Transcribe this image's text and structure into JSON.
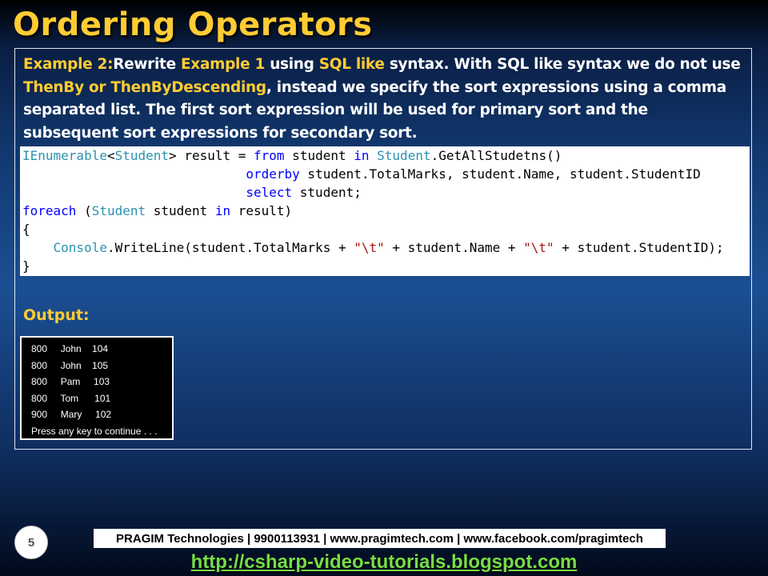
{
  "slide": {
    "title": "Ordering Operators",
    "page_number": "5"
  },
  "intro": {
    "example_label": "Example 2:",
    "t1": "Rewrite ",
    "example_ref": "Example 1",
    "t2": " using ",
    "sql_like": "SQL like",
    "t3": " syntax. With SQL like syntax we do not use ",
    "thenby": "ThenBy or ThenByDescending",
    "t4": ", instead we specify the sort expressions using a comma separated list. The first sort expression will be used for primary sort and the subsequent sort expressions for secondary sort."
  },
  "code": {
    "l1_type1": "IEnumerable",
    "l1_lt": "<",
    "l1_type2": "Student",
    "l1_mid": "> result = ",
    "l1_from": "from",
    "l1_student": " student ",
    "l1_in": "in",
    "l1_sp": " ",
    "l1_type3": "Student",
    "l1_tail": ".GetAllStudetns()",
    "l2_indent": "                             ",
    "l2_orderby": "orderby",
    "l2_tail": " student.TotalMarks, student.Name, student.StudentID",
    "l3_indent": "                             ",
    "l3_select": "select",
    "l3_tail": " student;",
    "l4_foreach": "foreach",
    "l4_paren": " (",
    "l4_type": "Student",
    "l4_student": " student ",
    "l4_in": "in",
    "l4_tail": " result)",
    "l5": "{",
    "l6_indent": "    ",
    "l6_type": "Console",
    "l6_a": ".WriteLine(student.TotalMarks + ",
    "l6_str1": "\"\\t\"",
    "l6_b": " + student.Name + ",
    "l6_str2": "\"\\t\"",
    "l6_c": " + student.StudentID);",
    "l7": "}"
  },
  "output": {
    "label": "Output:",
    "lines": [
      "800     John    104",
      "800     John    105",
      "800     Pam     103",
      "800     Tom      101",
      "900     Mary     102",
      "Press any key to continue . . ."
    ]
  },
  "footer": {
    "company": "PRAGIM Technologies | 9900113931 | www.pragimtech.com | www.facebook.com/pragimtech",
    "blog_url": "http://csharp-video-tutorials.blogspot.com"
  },
  "colors": {
    "accent": "#ffcc33",
    "keyword": "#0000ff",
    "type": "#2b91af",
    "string": "#a31515",
    "link": "#77dd44"
  }
}
